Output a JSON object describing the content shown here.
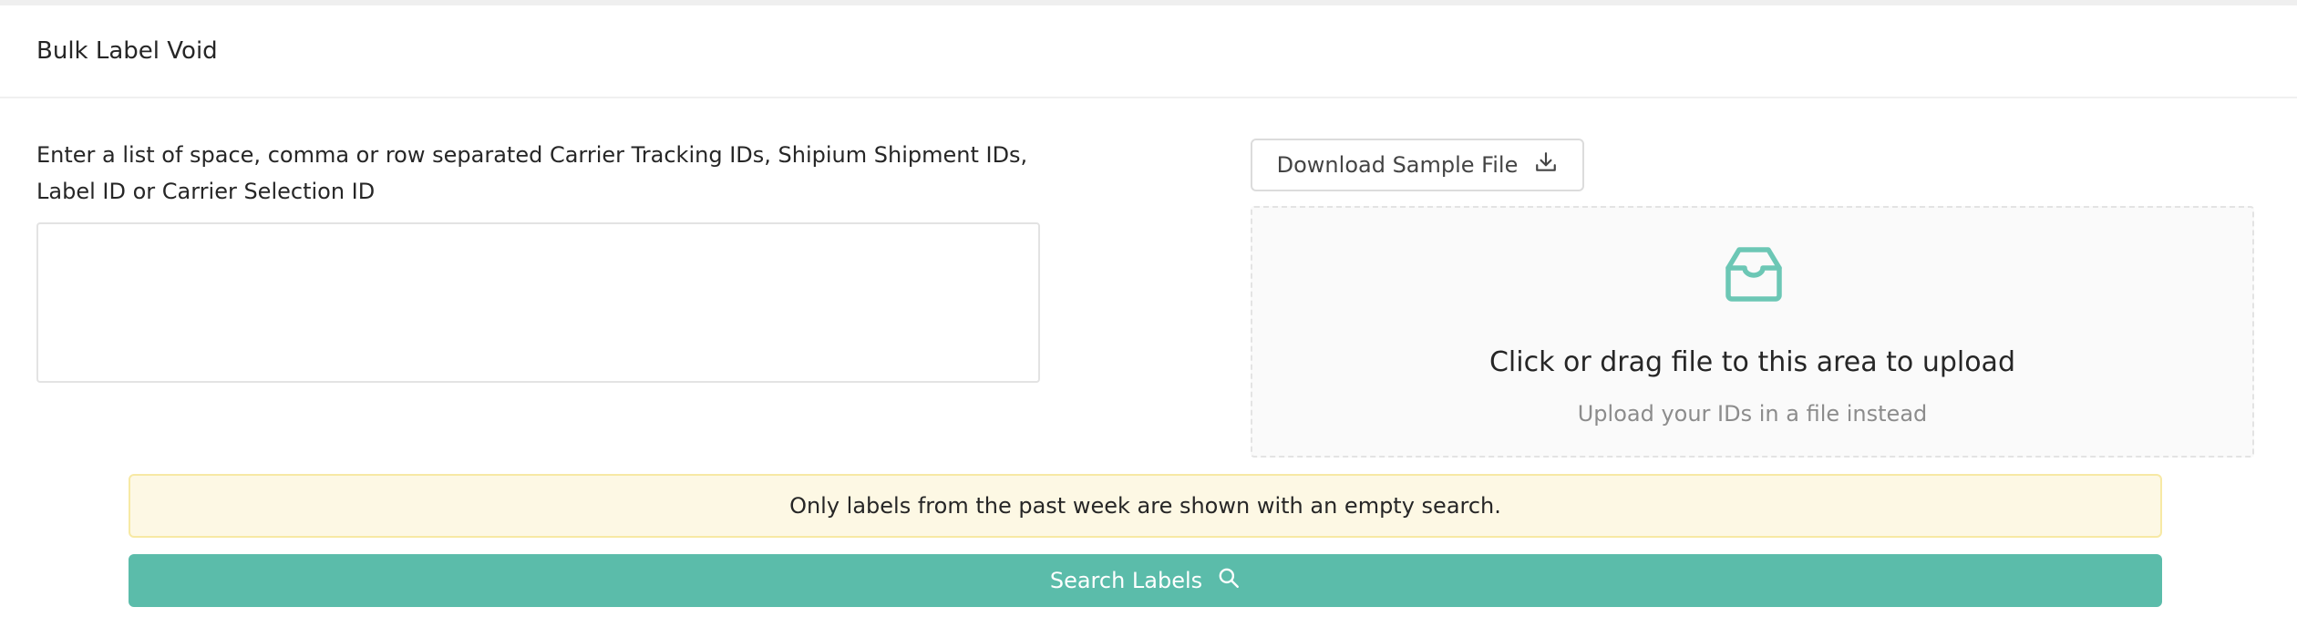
{
  "card": {
    "title": "Bulk Label Void"
  },
  "form": {
    "instructions": "Enter a list of space, comma or row separated Carrier Tracking IDs, Shipium Shipment IDs, Label ID or Carrier Selection ID",
    "ids_value": "",
    "ids_placeholder": ""
  },
  "upload": {
    "download_label": "Download Sample File",
    "download_icon": "download-icon",
    "dropzone_icon": "inbox-icon",
    "dropzone_title": "Click or drag file to this area to upload",
    "dropzone_hint": "Upload your IDs in a file instead"
  },
  "alert": {
    "message": "Only labels from the past week are shown with an empty search."
  },
  "search": {
    "label": "Search Labels",
    "icon": "search-icon"
  },
  "colors": {
    "accent": "#5bbcaa",
    "icon_teal": "#6cc7b5",
    "alert_bg": "#fdf8e4",
    "alert_border": "#f7e9a4",
    "dropzone_bg": "#fafafa"
  }
}
